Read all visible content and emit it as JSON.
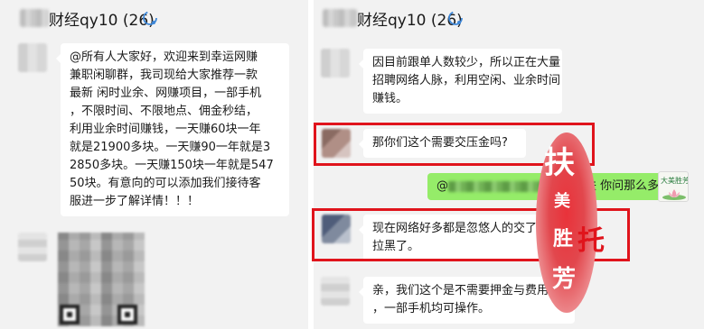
{
  "left_panel": {
    "title": "财经qy10 (26)",
    "messages": [
      {
        "lines": [
          "@所有人大家好，欢迎来到幸运网赚",
          "兼职闲聊群，我司现给大家推荐一款",
          "最新 闲时业余、网赚项目，一部手机",
          "，不限时间、不限地点、佣金秒结，",
          "利用业余时间赚钱，一天赚60块一年",
          "就是21900多块。一天赚90一年就是3",
          "2850多块。一天赚150块一年就是547",
          "50块。有意向的可以添加我们接待客",
          "服进一步了解详情！！！"
        ]
      }
    ]
  },
  "right_panel": {
    "title": "财经qy10 (26)",
    "messages": [
      {
        "lines": [
          "因目前跟单人数较少，所以正在大量",
          "招聘网络人脉，利用空闲、业余时间",
          "赚钱。"
        ]
      },
      {
        "lines": [
          "那你们这个需要交压金吗?"
        ]
      },
      {
        "self": true,
        "prefix": "@",
        "text": "你是真扶 你问那么多"
      },
      {
        "lines": [
          "现在网络好多都是忽悠人的交了钱就",
          "拉黑了。"
        ]
      },
      {
        "lines": [
          "亲，我们这个是不需要押金与费用的",
          "，一部手机均可操作。"
        ]
      }
    ]
  },
  "annotations": {
    "stamp_chars": [
      "扶",
      "美",
      "胜",
      "芳"
    ],
    "tuo_label": "托",
    "self_avatar_label": "大美胜芳",
    "box_color": "#e0141c",
    "stamp_color": "#e9323a"
  },
  "colors": {
    "chat_bg": "#f2f2f2",
    "bubble_incoming": "#ffffff",
    "bubble_outgoing": "#95ec69"
  },
  "icons": {
    "title_status": "chat-loading-icon"
  }
}
